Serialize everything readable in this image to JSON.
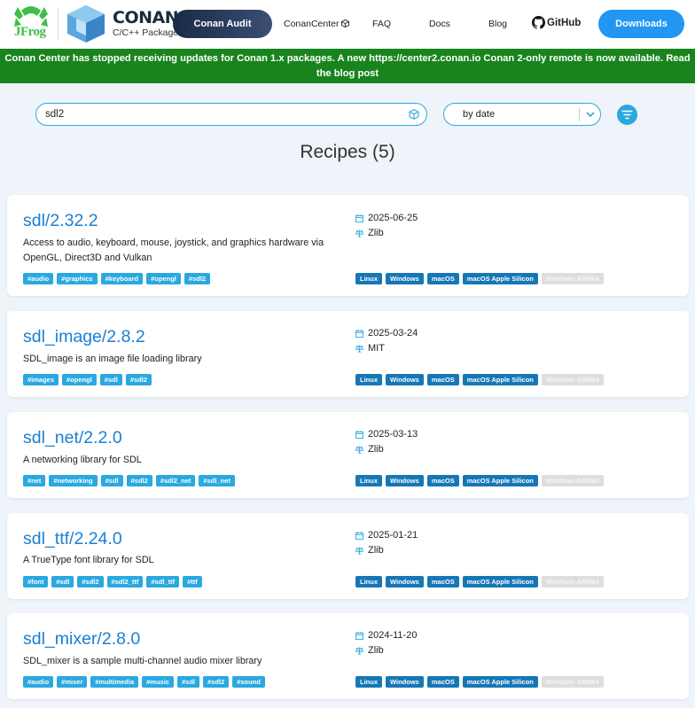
{
  "header": {
    "jfrog_logo_text": "JFrog",
    "conan_title": "CONAN",
    "conan_subtitle": "C/C++ Package Manager",
    "nav": {
      "audit": "Conan Audit",
      "conancenter": "ConanCenter",
      "faq": "FAQ",
      "docs": "Docs",
      "blog": "Blog",
      "github": "GitHub"
    },
    "downloads": "Downloads",
    "colors": {
      "accent": "#2196f3",
      "audit_dark": "#1a2a45"
    }
  },
  "banner": {
    "text": "Conan Center has stopped receiving updates for Conan 1.x packages. A new https://center2.conan.io Conan 2-only remote is now available. Read the blog post",
    "color": "#19841d"
  },
  "search": {
    "value": "sdl2",
    "icon": "cube-search-icon"
  },
  "sort": {
    "selected": "by date"
  },
  "recipes_heading": "Recipes (5)",
  "recipes": [
    {
      "name": "sdl/2.32.2",
      "description": "Access to audio, keyboard, mouse, joystick, and graphics hardware via OpenGL, Direct3D and Vulkan",
      "date": "2025-06-25",
      "license": "Zlib",
      "tags": [
        "#audio",
        "#graphics",
        "#keyboard",
        "#opengl",
        "#sdl2"
      ],
      "platforms": [
        {
          "label": "Linux",
          "enabled": true
        },
        {
          "label": "Windows",
          "enabled": true
        },
        {
          "label": "macOS",
          "enabled": true
        },
        {
          "label": "macOS Apple Silicon",
          "enabled": true
        },
        {
          "label": "Windows ARM64",
          "enabled": false
        }
      ]
    },
    {
      "name": "sdl_image/2.8.2",
      "description": "SDL_image is an image file loading library",
      "date": "2025-03-24",
      "license": "MIT",
      "tags": [
        "#images",
        "#opengl",
        "#sdl",
        "#sdl2"
      ],
      "platforms": [
        {
          "label": "Linux",
          "enabled": true
        },
        {
          "label": "Windows",
          "enabled": true
        },
        {
          "label": "macOS",
          "enabled": true
        },
        {
          "label": "macOS Apple Silicon",
          "enabled": true
        },
        {
          "label": "Windows ARM64",
          "enabled": false
        }
      ]
    },
    {
      "name": "sdl_net/2.2.0",
      "description": "A networking library for SDL",
      "date": "2025-03-13",
      "license": "Zlib",
      "tags": [
        "#net",
        "#networking",
        "#sdl",
        "#sdl2",
        "#sdl2_net",
        "#sdl_net"
      ],
      "platforms": [
        {
          "label": "Linux",
          "enabled": true
        },
        {
          "label": "Windows",
          "enabled": true
        },
        {
          "label": "macOS",
          "enabled": true
        },
        {
          "label": "macOS Apple Silicon",
          "enabled": true
        },
        {
          "label": "Windows ARM64",
          "enabled": false
        }
      ]
    },
    {
      "name": "sdl_ttf/2.24.0",
      "description": "A TrueType font library for SDL",
      "date": "2025-01-21",
      "license": "Zlib",
      "tags": [
        "#font",
        "#sdl",
        "#sdl2",
        "#sdl2_ttf",
        "#sdl_ttf",
        "#ttf"
      ],
      "platforms": [
        {
          "label": "Linux",
          "enabled": true
        },
        {
          "label": "Windows",
          "enabled": true
        },
        {
          "label": "macOS",
          "enabled": true
        },
        {
          "label": "macOS Apple Silicon",
          "enabled": true
        },
        {
          "label": "Windows ARM64",
          "enabled": false
        }
      ]
    },
    {
      "name": "sdl_mixer/2.8.0",
      "description": "SDL_mixer is a sample multi-channel audio mixer library",
      "date": "2024-11-20",
      "license": "Zlib",
      "tags": [
        "#audio",
        "#mixer",
        "#multimedia",
        "#music",
        "#sdl",
        "#sdl2",
        "#sound"
      ],
      "platforms": [
        {
          "label": "Linux",
          "enabled": true
        },
        {
          "label": "Windows",
          "enabled": true
        },
        {
          "label": "macOS",
          "enabled": true
        },
        {
          "label": "macOS Apple Silicon",
          "enabled": true
        },
        {
          "label": "Windows ARM64",
          "enabled": false
        }
      ]
    }
  ]
}
